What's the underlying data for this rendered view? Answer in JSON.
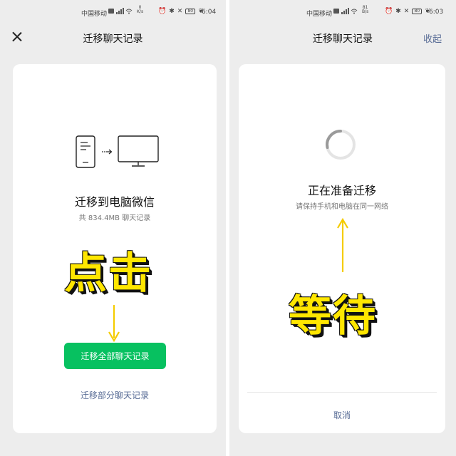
{
  "left_screen": {
    "status": {
      "carrier": "中国移动",
      "speed_value": "0",
      "speed_unit": "K/s",
      "battery": "80",
      "time": "6:04"
    },
    "nav": {
      "title": "迁移聊天记录",
      "close_icon": "close-icon"
    },
    "card": {
      "illustration": "phone-to-computer-icon",
      "heading": "迁移到电脑微信",
      "subtext": "共 834.4MB 聊天记录",
      "annotation": "点击",
      "primary_button": "迁移全部聊天记录",
      "secondary_link": "迁移部分聊天记录"
    }
  },
  "right_screen": {
    "status": {
      "carrier": "中国移动",
      "speed_value": "81",
      "speed_unit": "B/s",
      "battery": "80",
      "time": "6:03"
    },
    "nav": {
      "title": "迁移聊天记录",
      "collapse_label": "收起"
    },
    "card": {
      "spinner_icon": "loading-spinner-icon",
      "heading": "正在准备迁移",
      "subtext": "请保持手机和电脑在同一网络",
      "annotation": "等待",
      "cancel_button": "取消"
    }
  },
  "colors": {
    "accent_green": "#07c160",
    "link_blue": "#576b95",
    "annotation_yellow": "#ffe600",
    "background": "#ededed"
  }
}
